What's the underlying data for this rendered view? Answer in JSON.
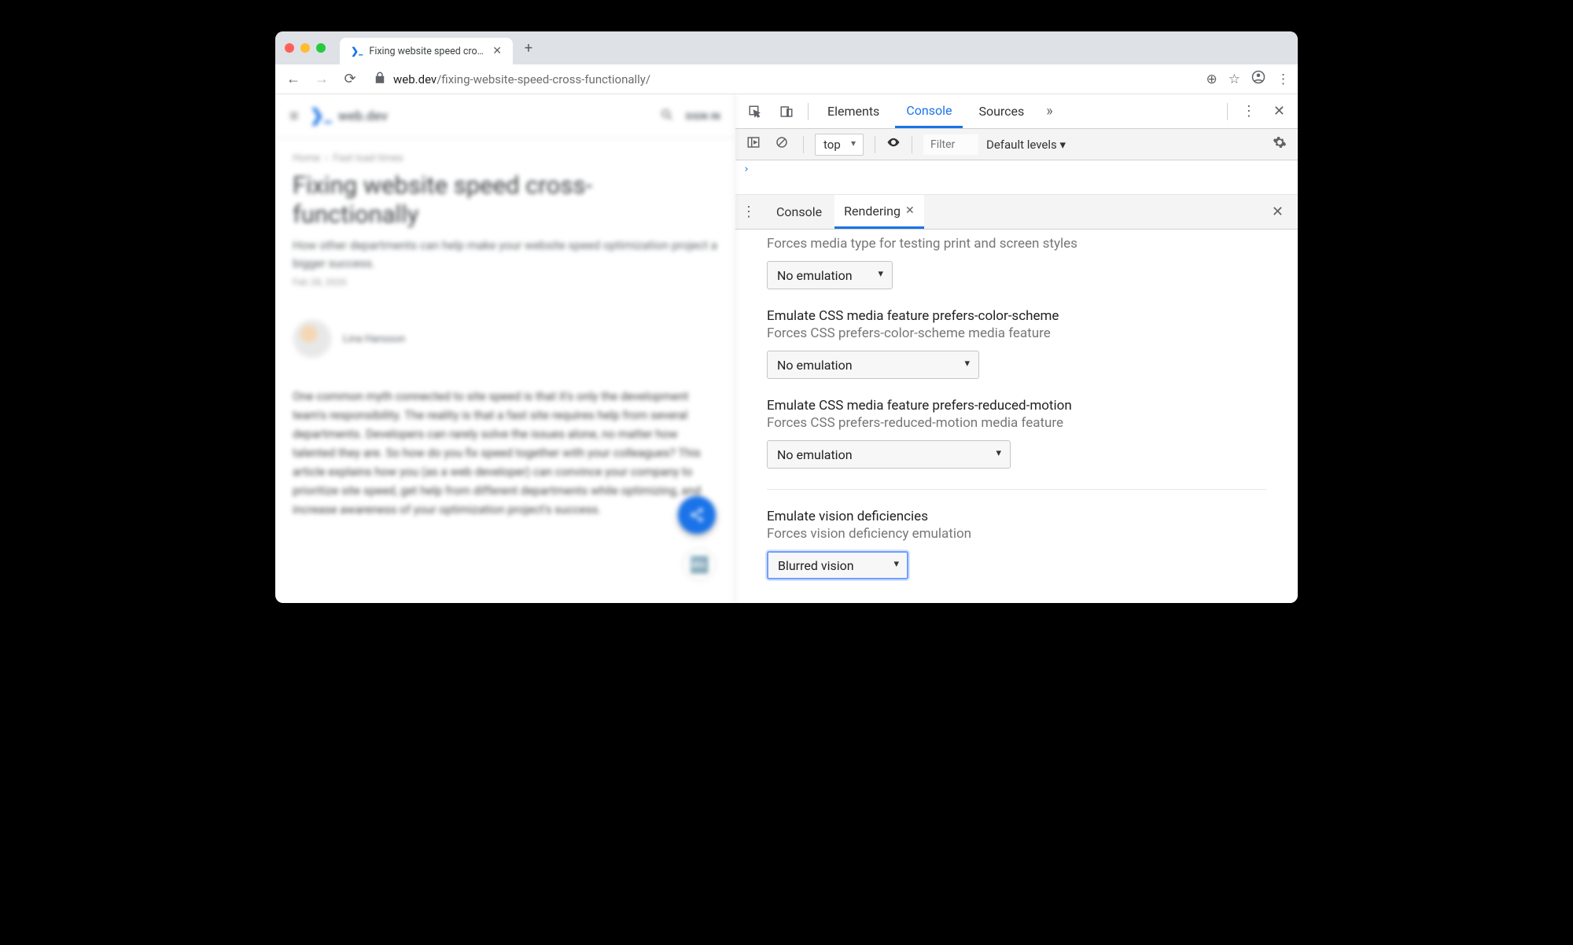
{
  "browser": {
    "tab_title": "Fixing website speed cross-fun",
    "url_host": "web.dev",
    "url_path": "/fixing-website-speed-cross-functionally/"
  },
  "page": {
    "brand": "web.dev",
    "sign_in": "SIGN IN",
    "breadcrumb_home": "Home",
    "breadcrumb_section": "Fast load times",
    "h1": "Fixing website speed cross-functionally",
    "subtitle": "How other departments can help make your website speed optimization project a bigger success.",
    "date": "Feb 28, 2020",
    "author": "Lina Hansson",
    "body": "One common myth connected to site speed is that it's only the development team's responsibility. The reality is that a fast site requires help from several departments. Developers can rarely solve the issues alone, no matter how talented they are. So how do you fix speed together with your colleagues? This article explains how you (as a web developer) can convince your company to prioritize site speed, get help from different departments while optimizing, and increase awareness of your optimization project's success."
  },
  "devtools": {
    "tabs": {
      "elements": "Elements",
      "console": "Console",
      "sources": "Sources"
    },
    "context": "top",
    "filter_placeholder": "Filter",
    "levels": "Default levels ▾",
    "console_prompt": "›",
    "drawer_console": "Console",
    "drawer_rendering": "Rendering"
  },
  "rendering": {
    "media_desc": "Forces media type for testing print and screen styles",
    "media_value": "No emulation",
    "scheme_title": "Emulate CSS media feature prefers-color-scheme",
    "scheme_desc": "Forces CSS prefers-color-scheme media feature",
    "scheme_value": "No emulation",
    "motion_title": "Emulate CSS media feature prefers-reduced-motion",
    "motion_desc": "Forces CSS prefers-reduced-motion media feature",
    "motion_value": "No emulation",
    "vision_title": "Emulate vision deficiencies",
    "vision_desc": "Forces vision deficiency emulation",
    "vision_value": "Blurred vision"
  }
}
